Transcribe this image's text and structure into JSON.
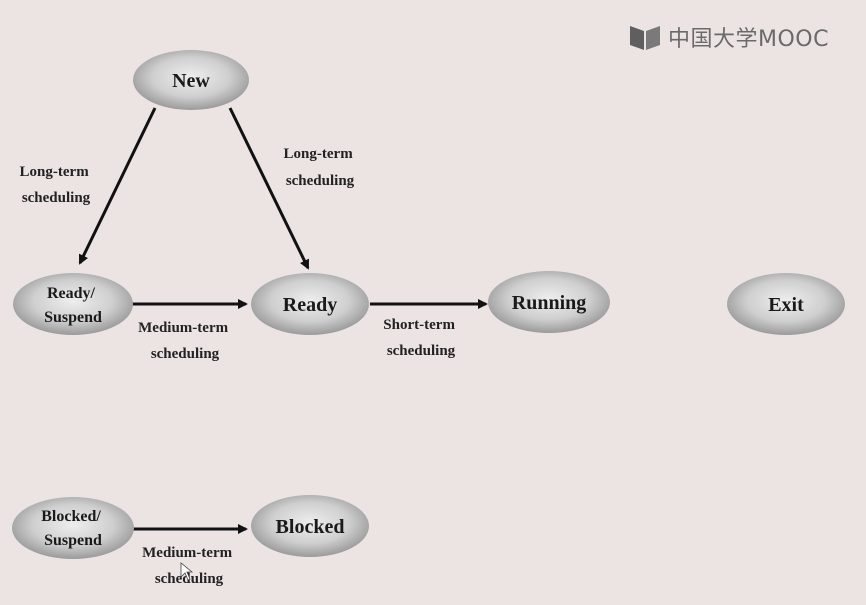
{
  "watermark": {
    "text": "中国大学MOOC"
  },
  "nodes": {
    "new": {
      "line1": "New",
      "line2": ""
    },
    "ready_suspend": {
      "line1": "Ready/",
      "line2": "Suspend"
    },
    "ready": {
      "line1": "Ready",
      "line2": ""
    },
    "running": {
      "line1": "Running",
      "line2": ""
    },
    "exit": {
      "line1": "Exit",
      "line2": ""
    },
    "blocked_suspend": {
      "line1": "Blocked/",
      "line2": "Suspend"
    },
    "blocked": {
      "line1": "Blocked",
      "line2": ""
    }
  },
  "edges": {
    "new_to_ready_suspend": {
      "line1": "Long-term",
      "line2": "scheduling"
    },
    "new_to_ready": {
      "line1": "Long-term",
      "line2": "scheduling"
    },
    "ready_suspend_to_ready": {
      "line1": "Medium-term",
      "line2": "scheduling"
    },
    "ready_to_running": {
      "line1": "Short-term",
      "line2": "scheduling"
    },
    "blocked_suspend_to_blocked": {
      "line1": "Medium-term",
      "line2": "scheduling"
    }
  }
}
